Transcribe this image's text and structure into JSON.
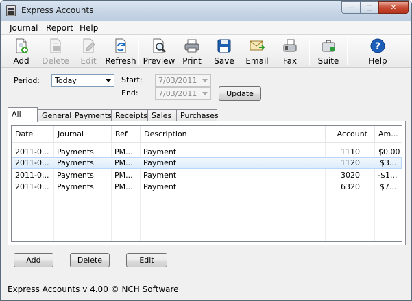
{
  "window": {
    "title": "Express Accounts",
    "controls": {
      "minimize": "—",
      "maximize": "□",
      "close": "✕"
    }
  },
  "menubar": {
    "items": [
      "Journal",
      "Report",
      "Help"
    ]
  },
  "toolbar": {
    "buttons": [
      {
        "label": "Add",
        "icon": "add-document-icon",
        "enabled": true
      },
      {
        "label": "Delete",
        "icon": "delete-document-icon",
        "enabled": false
      },
      {
        "label": "Edit",
        "icon": "edit-document-icon",
        "enabled": false
      },
      {
        "label": "Refresh",
        "icon": "refresh-document-icon",
        "enabled": true
      },
      {
        "label": "Preview",
        "icon": "preview-magnifier-icon",
        "enabled": true
      },
      {
        "label": "Print",
        "icon": "printer-icon",
        "enabled": true
      },
      {
        "label": "Save",
        "icon": "floppy-disk-icon",
        "enabled": true
      },
      {
        "label": "Email",
        "icon": "email-envelope-icon",
        "enabled": true
      },
      {
        "label": "Fax",
        "icon": "fax-machine-icon",
        "enabled": true
      },
      {
        "label": "Suite",
        "icon": "briefcase-icon",
        "enabled": true
      },
      {
        "label": "Help",
        "icon": "help-question-icon",
        "enabled": true
      }
    ]
  },
  "filters": {
    "period_label": "Period:",
    "period_value": "Today",
    "start_label": "Start:",
    "start_value": "7/03/2011",
    "end_label": "End:",
    "end_value": "7/03/2011",
    "update_label": "Update"
  },
  "tabs": [
    "All",
    "General",
    "Payments",
    "Receipts",
    "Sales",
    "Purchases"
  ],
  "active_tab": "All",
  "table": {
    "headers": [
      "Date",
      "Journal",
      "Ref",
      "Description",
      "Account",
      "Am..."
    ],
    "rows": [
      [
        "2011-0...",
        "Payments",
        "PM...",
        "Payment",
        "1110",
        "$0.00"
      ],
      [
        "2011-0...",
        "Payments",
        "PM...",
        "Payment",
        "1120",
        "$3..."
      ],
      [
        "2011-0...",
        "Payments",
        "PM...",
        "Payment",
        "3020",
        "-$1..."
      ],
      [
        "2011-0...",
        "Payments",
        "PM...",
        "Payment",
        "6320",
        "$7..."
      ]
    ],
    "selected_row": 1
  },
  "actions": {
    "add": "Add",
    "delete": "Delete",
    "edit": "Edit"
  },
  "statusbar": {
    "text": "Express Accounts v 4.00 © NCH Software"
  },
  "colors": {
    "accent": "#0b5cad",
    "selection": "#dcecfb",
    "close_button": "#c74a33"
  }
}
